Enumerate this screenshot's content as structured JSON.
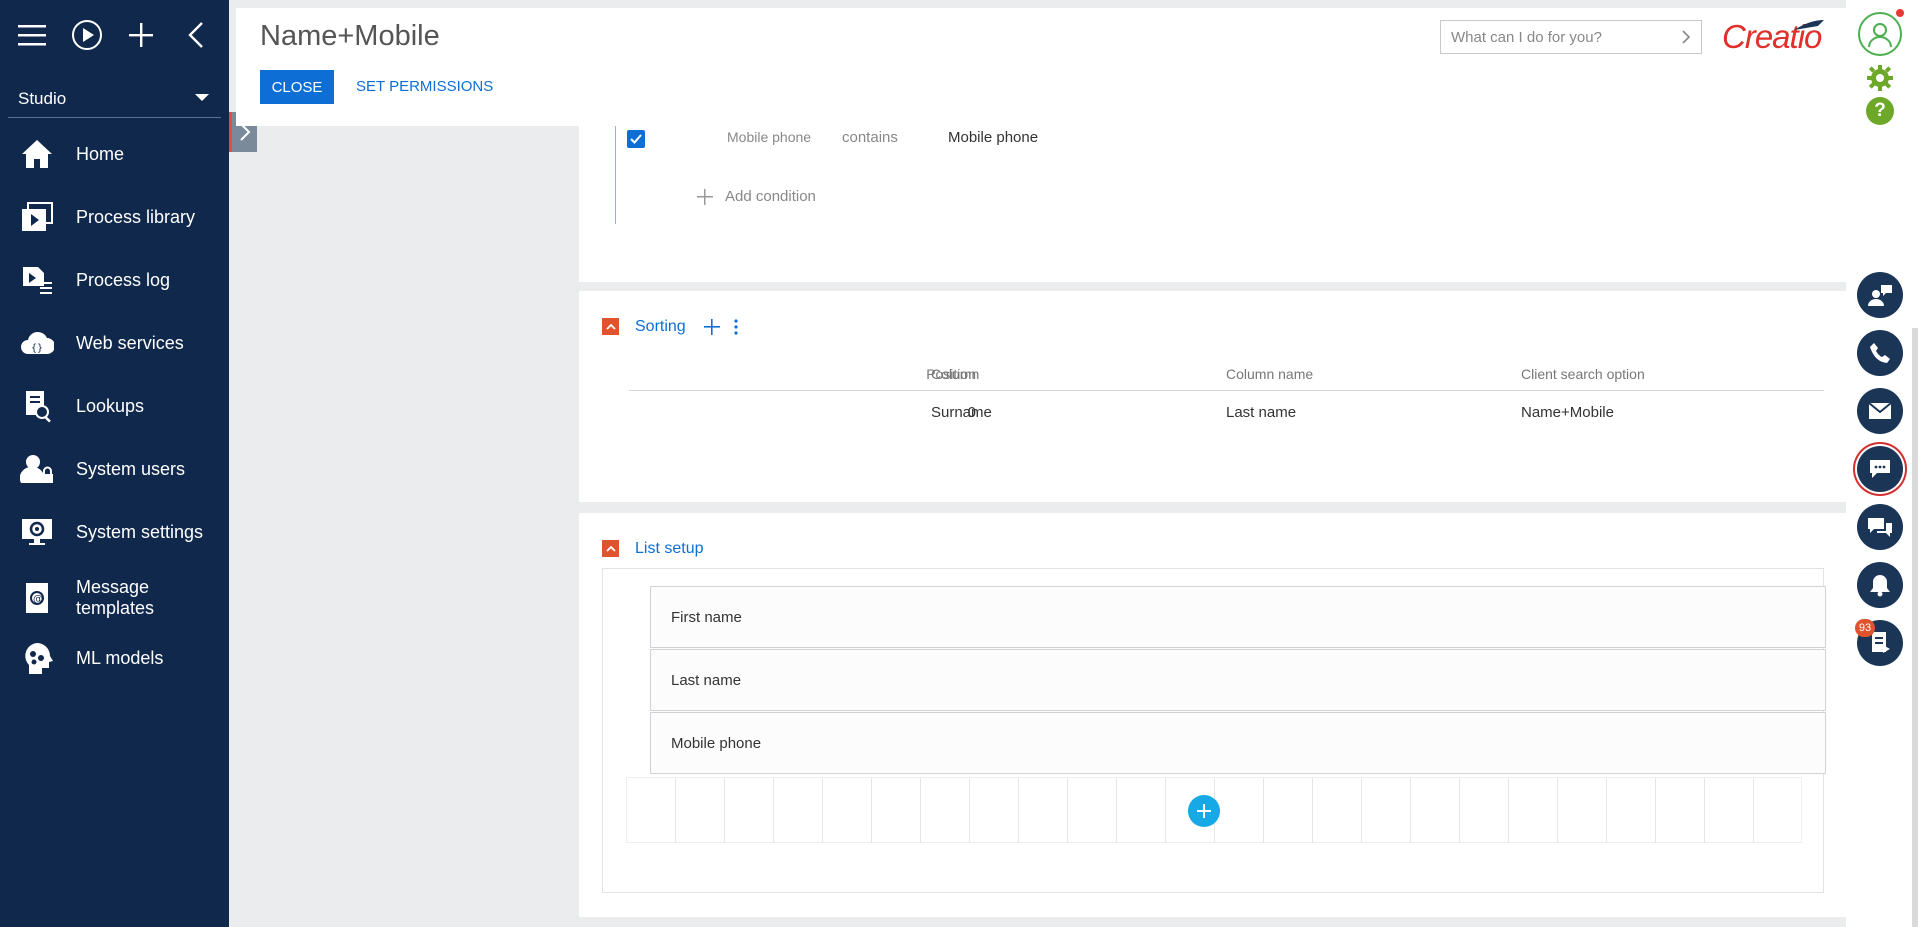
{
  "sidebar": {
    "workspace": "Studio",
    "items": [
      {
        "label": "Home"
      },
      {
        "label": "Process library"
      },
      {
        "label": "Process log"
      },
      {
        "label": "Web services"
      },
      {
        "label": "Lookups"
      },
      {
        "label": "System users"
      },
      {
        "label": "System settings"
      },
      {
        "label": "Message\ntemplates"
      },
      {
        "label": "ML models"
      }
    ]
  },
  "header": {
    "title": "Name+Mobile",
    "close_label": "CLOSE",
    "permissions_label": "SET PERMISSIONS",
    "search_placeholder": "What can I do for you?",
    "logo": "Creatio"
  },
  "filter": {
    "condition": {
      "column": "Mobile phone",
      "operator": "contains",
      "value": "Mobile phone",
      "checked": true
    },
    "add_condition_label": "Add condition"
  },
  "sorting": {
    "title": "Sorting",
    "columns": [
      "Position",
      "Column",
      "Column name",
      "Client search option"
    ],
    "rows": [
      {
        "position": "0",
        "column": "Surname",
        "column_name": "Last name",
        "option": "Name+Mobile"
      }
    ]
  },
  "list_setup": {
    "title": "List setup",
    "fields": [
      "First name",
      "Last name",
      "Mobile phone"
    ]
  },
  "rightbar": {
    "notification_count": "93"
  },
  "colors": {
    "sidebar_bg": "#10284b",
    "accent_blue": "#0d6fd6",
    "collapse_orange": "#e0542d",
    "logo_red": "#e0302b",
    "add_button": "#17a9e6"
  }
}
